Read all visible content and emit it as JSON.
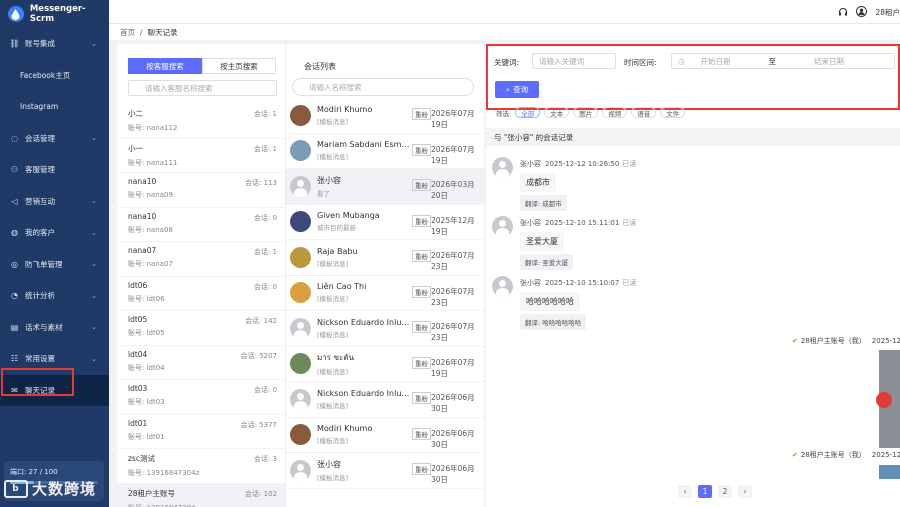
{
  "app": {
    "name": "Messenger-Scrm"
  },
  "sidebar": {
    "items": [
      {
        "label": "账号集成",
        "icon": "link-icon",
        "chev": "⌄"
      },
      {
        "label": "Facebook主页",
        "icon": "",
        "chev": ""
      },
      {
        "label": "Instagram",
        "icon": "",
        "chev": ""
      },
      {
        "label": "会话管理",
        "icon": "chat-icon",
        "chev": "⌄"
      },
      {
        "label": "客服管理",
        "icon": "user-icon",
        "chev": ""
      },
      {
        "label": "营销互动",
        "icon": "megaphone-icon",
        "chev": "⌄"
      },
      {
        "label": "我的客户",
        "icon": "customer-icon",
        "chev": "⌄"
      },
      {
        "label": "防飞单管理",
        "icon": "shield-icon",
        "chev": "⌄"
      },
      {
        "label": "统计分析",
        "icon": "chart-icon",
        "chev": "⌄"
      },
      {
        "label": "话术与素材",
        "icon": "doc-icon",
        "chev": "⌄"
      },
      {
        "label": "常用设置",
        "icon": "settings-icon",
        "chev": "⌄"
      },
      {
        "label": "聊天记录",
        "icon": "mail-icon",
        "chev": ""
      }
    ],
    "quota": {
      "label": "端口: 27 / 100",
      "fill": 0.27
    },
    "watermark": "大数跨境"
  },
  "topbar": {
    "user": "28租户"
  },
  "breadcrumb": {
    "home": "首页",
    "sep": "/",
    "current": "聊天记录"
  },
  "agents_panel": {
    "tab_by_agent": "按客服搜索",
    "tab_by_page": "按主页搜索",
    "search_placeholder": "请输入客服名称搜索",
    "agents": [
      {
        "name": "小二",
        "count": "会话: 1",
        "account": "账号: nana112"
      },
      {
        "name": "小一",
        "count": "会话: 1",
        "account": "账号: nana111"
      },
      {
        "name": "nana10",
        "count": "会话: 113",
        "account": "账号: nana09"
      },
      {
        "name": "nana10",
        "count": "会话: 0",
        "account": "账号: nana08"
      },
      {
        "name": "nana07",
        "count": "会话: 1",
        "account": "账号: nana07"
      },
      {
        "name": "ldt06",
        "count": "会话: 0",
        "account": "账号: ldt06"
      },
      {
        "name": "ldt05",
        "count": "会话: 142",
        "account": "账号: ldt05"
      },
      {
        "name": "ldt04",
        "count": "会话: 5207",
        "account": "账号: ldt04"
      },
      {
        "name": "ldt03",
        "count": "会话: 0",
        "account": "账号: ldt03"
      },
      {
        "name": "ldt01",
        "count": "会话: 5377",
        "account": "账号: ldt01"
      },
      {
        "name": "zsc测试",
        "count": "会话: 3",
        "account": "账号: 13916847304z"
      },
      {
        "name": "28租户主账号",
        "count": "会话: 102",
        "account": "账号: 13916847304"
      }
    ]
  },
  "conversations_panel": {
    "title": "会话列表",
    "search_placeholder": "请输入名称搜索",
    "items": [
      {
        "name": "Modiri Khumo",
        "sub": "[模板消息]",
        "tag": "重粉",
        "date": "2026年07月19日",
        "avatar": "#8a5a3c"
      },
      {
        "name": "Mariam Sabdani Esmael",
        "sub": "[模板消息]",
        "tag": "重粉",
        "date": "2026年07月19日",
        "avatar": "#7d9cb5"
      },
      {
        "name": "张小容",
        "sub": "看了",
        "tag": "重粉",
        "date": "2026年03月20日",
        "avatar": "default"
      },
      {
        "name": "Given Mubanga",
        "sub": "城市目的最新",
        "tag": "重粉",
        "date": "2025年12月19日",
        "avatar": "#3b4a7a"
      },
      {
        "name": "Raja Babu",
        "sub": "[模板消息]",
        "tag": "重粉",
        "date": "2026年07月23日",
        "avatar": "#b89a3c"
      },
      {
        "name": "Liên Cao Thi",
        "sub": "[模板消息]",
        "tag": "重粉",
        "date": "2026年07月23日",
        "avatar": "#d9a040"
      },
      {
        "name": "Nickson Eduardo Inlua...",
        "sub": "[模板消息]",
        "tag": "重粉",
        "date": "2026年07月23日",
        "avatar": "default"
      },
      {
        "name": "มาร ขะตัน",
        "sub": "[模板消息]",
        "tag": "重粉",
        "date": "2026年07月19日",
        "avatar": "#6d8a5a"
      },
      {
        "name": "Nickson Eduardo Inlua...",
        "sub": "[模板消息]",
        "tag": "重粉",
        "date": "2026年06月30日",
        "avatar": "default"
      },
      {
        "name": "Modiri Khumo",
        "sub": "[模板消息]",
        "tag": "重粉",
        "date": "2026年06月30日",
        "avatar": "#8a5a3c"
      },
      {
        "name": "张小容",
        "sub": "[模板消息]",
        "tag": "重粉",
        "date": "2026年06月30日",
        "avatar": "default"
      }
    ]
  },
  "filter": {
    "keyword_label": "关键词:",
    "keyword_placeholder": "请输入关键词",
    "range_label": "时间区间:",
    "start_placeholder": "开始日期",
    "range_sep": "至",
    "end_placeholder": "结束日期",
    "query_label": "查询",
    "chips_label": "筛选:",
    "chips": [
      "全部",
      "文本",
      "图片",
      "视频",
      "语音",
      "文件"
    ]
  },
  "chat": {
    "header": "与 \"张小容\" 的会话记录",
    "messages": [
      {
        "sender": "张小容",
        "time": "2025-12-12 10:26:50",
        "status": "已读",
        "text": "成都市",
        "translation": "翻译: 成都市"
      },
      {
        "sender": "张小容",
        "time": "2025-12-10 15:11:01",
        "status": "已读",
        "text": "圣爱大厦",
        "translation": "翻译: 圣爱大厦"
      },
      {
        "sender": "张小容",
        "time": "2025-12-10 15:10:07",
        "status": "已读",
        "text": "哈哈哈哈哈哈",
        "translation": "翻译: 哈哈哈哈哈哈"
      }
    ],
    "outgoing": [
      {
        "sender": "28租户主账号（我）",
        "time": "2025-12-1"
      },
      {
        "sender": "28租户主账号（我）",
        "time": "2025-12-1"
      }
    ],
    "pager": [
      "‹",
      "1",
      "2",
      "›"
    ]
  }
}
